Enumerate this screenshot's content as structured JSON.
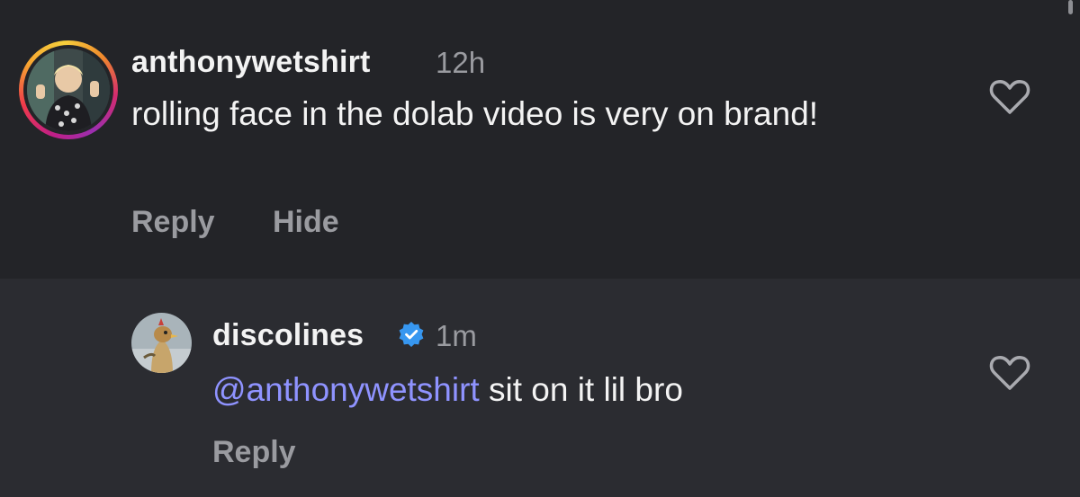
{
  "comment": {
    "username": "anthonywetshirt",
    "time": "12h",
    "text": "rolling face in the dolab video is very on brand!",
    "reply_label": "Reply",
    "hide_label": "Hide",
    "avatar_icon": "profile-photo",
    "story_ring_colors": [
      "#c01f86",
      "#f03a4a",
      "#f7a531",
      "#f6d03c"
    ]
  },
  "reply": {
    "username": "discolines",
    "verified": true,
    "verified_color": "#3797f0",
    "time": "1m",
    "mention": "@anthonywetshirt",
    "text": " sit on it lil bro",
    "mention_color": "#8f93ff",
    "reply_label": "Reply",
    "avatar_icon": "profile-photo"
  },
  "icons": {
    "like": "heart-outline-icon",
    "verified": "verified-badge-icon"
  }
}
